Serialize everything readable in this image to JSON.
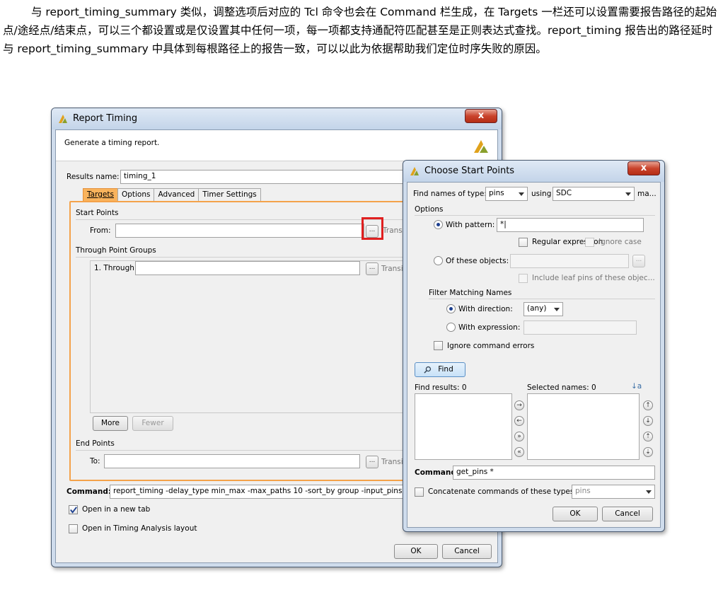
{
  "paragraph": "与 report_timing_summary 类似，调整选项后对应的 Tcl 命令也会在 Command 栏生成，在 Targets 一栏还可以设置需要报告路径的起始点/途经点/结束点，可以三个都设置或是仅设置其中任何一项，每一项都支持通配符匹配甚至是正则表达式查找。report_timing 报告出的路径延时与 report_timing_summary 中具体到每根路径上的报告一致，可以以此为依据帮助我们定位时序失败的原因。",
  "report_timing": {
    "title": "Report Timing",
    "close": "x",
    "subtitle": "Generate a timing report.",
    "results_name_label": "Results name:",
    "results_name_value": "timing_1",
    "tabs": [
      "Targets",
      "Options",
      "Advanced",
      "Timer Settings"
    ],
    "start_points": "Start Points",
    "from_label": "From:",
    "browse": "...",
    "transit_label": "Transi",
    "through_groups": "Through Point Groups",
    "through_label": "1. Through:",
    "more_btn": "More",
    "fewer_btn": "Fewer",
    "end_points": "End Points",
    "to_label": "To:",
    "command_label": "Command:",
    "command_value": "report_timing -delay_type min_max -max_paths 10 -sort_by group -input_pins -na",
    "open_new_tab": "Open in a new tab",
    "open_layout": "Open in Timing Analysis layout",
    "ok": "OK",
    "cancel": "Cancel"
  },
  "choose": {
    "title": "Choose Start Points",
    "close": "x",
    "find_type_label": "Find names of type:",
    "type_value": "pins",
    "using_label": "using",
    "using_value": "SDC",
    "ma": "ma...",
    "options": "Options",
    "with_pattern": "With pattern:",
    "pattern_value": "*",
    "regex": "Regular expression",
    "ignore_case": "Ignore case",
    "of_objects": "Of these objects:",
    "browse": "...",
    "include_leaf": "Include leaf pins of these objec...",
    "filter": "Filter Matching Names",
    "with_direction": "With direction:",
    "direction_value": "(any)",
    "with_expression": "With expression:",
    "ignore_errors": "Ignore command errors",
    "find_btn": "Find",
    "find_results": "Find results: 0",
    "selected_names": "Selected names: 0",
    "command_label": "Command:",
    "command_value": "get_pins *",
    "concat": "Concatenate commands of these types:",
    "concat_value": "pins",
    "ok": "OK",
    "cancel": "Cancel"
  },
  "colors": {
    "highlight": "#e02020",
    "tab_active": "#f9b35c",
    "group_border": "#f4a24a"
  }
}
